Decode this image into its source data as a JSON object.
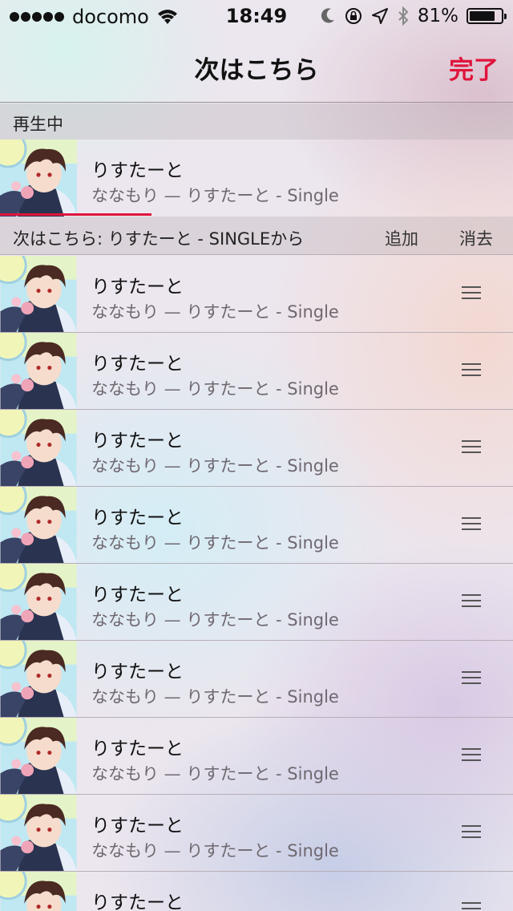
{
  "status_bar": {
    "carrier": "docomo",
    "time": "18:49",
    "battery_percent": "81%",
    "battery_level": 0.81,
    "icons": [
      "signal-dots-icon",
      "wifi-icon",
      "moon-icon",
      "rotation-lock-icon",
      "location-arrow-icon",
      "bluetooth-icon",
      "battery-icon"
    ]
  },
  "nav": {
    "title": "次はこちら",
    "done_label": "完了"
  },
  "colors": {
    "accent": "#e0153c"
  },
  "now_playing": {
    "header": "再生中",
    "title": "りすたーと",
    "subtitle": "ななもり — りすたーと - Single",
    "progress": 0.295
  },
  "queue": {
    "header": "次はこちら: りすたーと - SINGLEから",
    "add_label": "追加",
    "clear_label": "消去",
    "items": [
      {
        "title": "りすたーと",
        "subtitle": "ななもり — りすたーと - Single"
      },
      {
        "title": "りすたーと",
        "subtitle": "ななもり — りすたーと - Single"
      },
      {
        "title": "りすたーと",
        "subtitle": "ななもり — りすたーと - Single"
      },
      {
        "title": "りすたーと",
        "subtitle": "ななもり — りすたーと - Single"
      },
      {
        "title": "りすたーと",
        "subtitle": "ななもり — りすたーと - Single"
      },
      {
        "title": "りすたーと",
        "subtitle": "ななもり — りすたーと - Single"
      },
      {
        "title": "りすたーと",
        "subtitle": "ななもり — りすたーと - Single"
      },
      {
        "title": "りすたーと",
        "subtitle": "ななもり — りすたーと - Single"
      },
      {
        "title": "りすたーと",
        "subtitle": ""
      }
    ]
  }
}
